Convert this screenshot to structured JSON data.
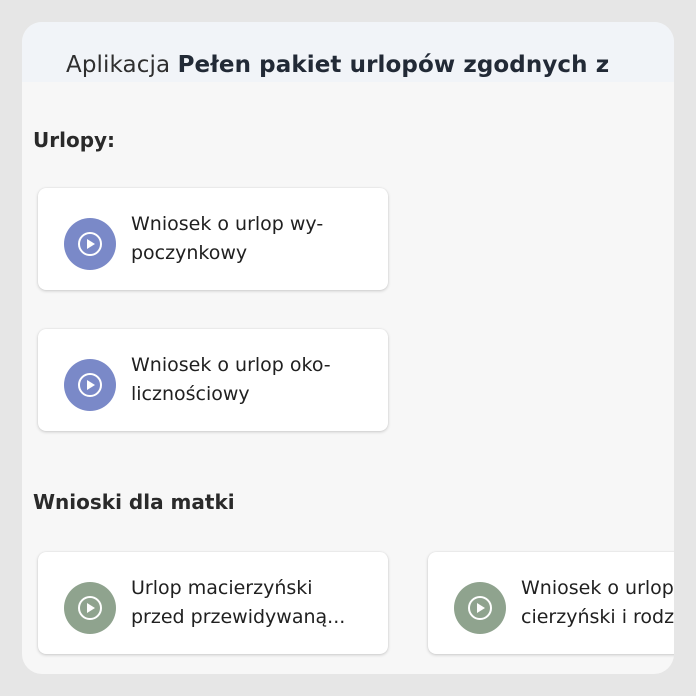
{
  "header": {
    "title_prefix": "Aplikacja",
    "title_bold": "Pełen pakiet urlopów zgodnych z"
  },
  "sections": [
    {
      "title": "Urlopy:",
      "cards": [
        {
          "line1": "Wniosek o urlop wy-",
          "line2": "poczynkowy",
          "icon": "play-circle-icon",
          "color": "#7a89c8"
        },
        {
          "line1": "Wniosek o urlop oko-",
          "line2": "licznościowy",
          "icon": "play-circle-icon",
          "color": "#7a89c8"
        }
      ]
    },
    {
      "title": "Wnioski dla matki",
      "cards": [
        {
          "line1": "Urlop macierzyński",
          "line2": "przed przewidywaną...",
          "icon": "play-circle-icon",
          "color": "#8fa38e"
        },
        {
          "line1": "Wniosek o urlop ma-",
          "line2": "cierzyński i rodzicielski",
          "icon": "play-circle-icon",
          "color": "#8fa38e"
        }
      ]
    }
  ]
}
